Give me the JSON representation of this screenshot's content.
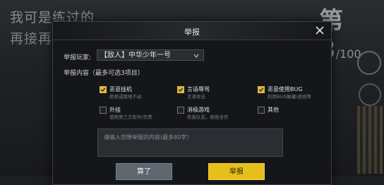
{
  "background": {
    "line1": "我可是练过的",
    "line2": "再接再",
    "rank": "第3",
    "rank_total": "/100"
  },
  "dialog": {
    "title": "举报",
    "player_label": "举报玩家:",
    "player_value": "【敌人】中华少年一号",
    "content_label": "举报内容（最多可选3项目）",
    "options": [
      {
        "title": "恶意挂机",
        "desc": "拒绝或原地不动",
        "checked": true
      },
      {
        "title": "言语辱骂",
        "desc": "言语攻击",
        "checked": true
      },
      {
        "title": "恶意使用BUG",
        "desc": "利用BUG躲藏/透视等",
        "checked": true
      },
      {
        "title": "外挂",
        "desc": "使用第三方软件/作弊",
        "checked": false
      },
      {
        "title": "消极游戏",
        "desc": "伤害队友，拒绝合作",
        "checked": false
      },
      {
        "title": "其他",
        "desc": "",
        "checked": false
      }
    ],
    "textbox_placeholder": "请输入您想举报的内容(最多80字）",
    "cancel_label": "算了",
    "submit_label": "举报"
  },
  "colors": {
    "accent": "#e5bf1c",
    "cancel": "#5e6670"
  }
}
